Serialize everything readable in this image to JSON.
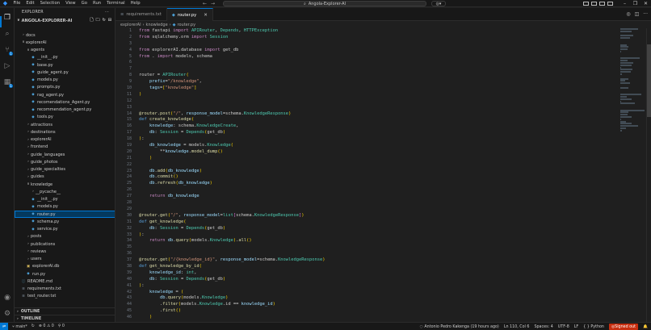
{
  "menu": [
    "File",
    "Edit",
    "Selection",
    "View",
    "Go",
    "Run",
    "Terminal",
    "Help"
  ],
  "command_center": "Angola-Explorer-AI",
  "sidebar": {
    "header": "EXPLORER",
    "root": "ANGOLA-EXPLORER-AI",
    "tree": [
      {
        "label": "docs",
        "depth": 1,
        "type": "folder",
        "open": false
      },
      {
        "label": "explorerAI",
        "depth": 1,
        "type": "folder",
        "open": true
      },
      {
        "label": "agents",
        "depth": 2,
        "type": "folder",
        "open": true
      },
      {
        "label": "__init__.py",
        "depth": 3,
        "type": "py"
      },
      {
        "label": "base.py",
        "depth": 3,
        "type": "py"
      },
      {
        "label": "guide_agent.py",
        "depth": 3,
        "type": "py"
      },
      {
        "label": "models.py",
        "depth": 3,
        "type": "py"
      },
      {
        "label": "prompts.py",
        "depth": 3,
        "type": "py"
      },
      {
        "label": "rag_agent.py",
        "depth": 3,
        "type": "py"
      },
      {
        "label": "recomendations_Agent.py",
        "depth": 3,
        "type": "py"
      },
      {
        "label": "recommendation_agent.py",
        "depth": 3,
        "type": "py"
      },
      {
        "label": "tools.py",
        "depth": 3,
        "type": "py"
      },
      {
        "label": "attractions",
        "depth": 2,
        "type": "folder",
        "open": false
      },
      {
        "label": "destinations",
        "depth": 2,
        "type": "folder",
        "open": false
      },
      {
        "label": "explorerAI",
        "depth": 2,
        "type": "folder",
        "open": false
      },
      {
        "label": "frontend",
        "depth": 2,
        "type": "folder",
        "open": false
      },
      {
        "label": "guide_languages",
        "depth": 2,
        "type": "folder",
        "open": false
      },
      {
        "label": "guide_photos",
        "depth": 2,
        "type": "folder",
        "open": false
      },
      {
        "label": "guide_specialties",
        "depth": 2,
        "type": "folder",
        "open": false
      },
      {
        "label": "guides",
        "depth": 2,
        "type": "folder",
        "open": false
      },
      {
        "label": "knowledge",
        "depth": 2,
        "type": "folder",
        "open": true
      },
      {
        "label": "__pycache__",
        "depth": 3,
        "type": "folder",
        "open": false
      },
      {
        "label": "__init__.py",
        "depth": 3,
        "type": "py"
      },
      {
        "label": "models.py",
        "depth": 3,
        "type": "py"
      },
      {
        "label": "router.py",
        "depth": 3,
        "type": "py",
        "selected": true
      },
      {
        "label": "schema.py",
        "depth": 3,
        "type": "py"
      },
      {
        "label": "service.py",
        "depth": 3,
        "type": "py"
      },
      {
        "label": "posts",
        "depth": 2,
        "type": "folder",
        "open": false
      },
      {
        "label": "publications",
        "depth": 2,
        "type": "folder",
        "open": false
      },
      {
        "label": "reviews",
        "depth": 2,
        "type": "folder",
        "open": false
      },
      {
        "label": "users",
        "depth": 2,
        "type": "folder",
        "open": false
      },
      {
        "label": "explorerAI.db",
        "depth": 2,
        "type": "db"
      },
      {
        "label": "run.py",
        "depth": 2,
        "type": "py"
      },
      {
        "label": "README.md",
        "depth": 1,
        "type": "md"
      },
      {
        "label": "requirements.txt",
        "depth": 1,
        "type": "txt"
      },
      {
        "label": "test_router.txt",
        "depth": 1,
        "type": "txt"
      }
    ],
    "outline": "OUTLINE",
    "timeline": "TIMELINE"
  },
  "tabs": [
    {
      "label": "requirements.txt",
      "icon": "txt",
      "active": false
    },
    {
      "label": "router.py",
      "icon": "py",
      "active": true
    }
  ],
  "breadcrumb": [
    "explorerAI",
    "knowledge",
    "router.py"
  ],
  "code_lines": [
    "from fastapi import APIRouter, Depends, HTTPException",
    "from sqlalchemy.orm import Session",
    "",
    "from explorerAI.database import get_db",
    "from . import models, schema",
    "",
    "",
    "router = APIRouter(",
    "    prefix=\"/knowledge\",",
    "    tags=[\"knowledge\"]",
    ")",
    "",
    "",
    "@router.post(\"/\", response_model=schema.KnowledgeResponse)",
    "def create_knowledge(",
    "    knowledge: schema.KnowledgeCreate,",
    "    db: Session = Depends(get_db)",
    "):",
    "    db_knowledge = models.Knowledge(",
    "        **knowledge.model_dump()",
    "    )",
    "",
    "    db.add(db_knowledge)",
    "    db.commit()",
    "    db.refresh(db_knowledge)",
    "",
    "    return db_knowledge",
    "",
    "",
    "@router.get(\"/\", response_model=list[schema.KnowledgeResponse])",
    "def get_knowledge(",
    "    db: Session = Depends(get_db)",
    "):",
    "    return db.query(models.Knowledge).all()",
    "",
    "",
    "@router.get(\"/{knowledge_id}\", response_model=schema.KnowledgeResponse)",
    "def get_knowledge_by_id(",
    "    knowledge_id: int,",
    "    db: Session = Depends(get_db)",
    "):",
    "    knowledge = (",
    "        db.query(models.Knowledge)",
    "        .filter(models.Knowledge.id == knowledge_id)",
    "        .first()",
    "    )"
  ],
  "status": {
    "branch": "main*",
    "problems": "0",
    "warnings": "0",
    "ports": "0",
    "blame": "Antonio Pedro Kakenga (19 hours ago)",
    "position": "Ln 110, Col 6",
    "spaces": "Spaces: 4",
    "encoding": "UTF-8",
    "eol": "LF",
    "language": "Python",
    "account": "Signed out"
  }
}
